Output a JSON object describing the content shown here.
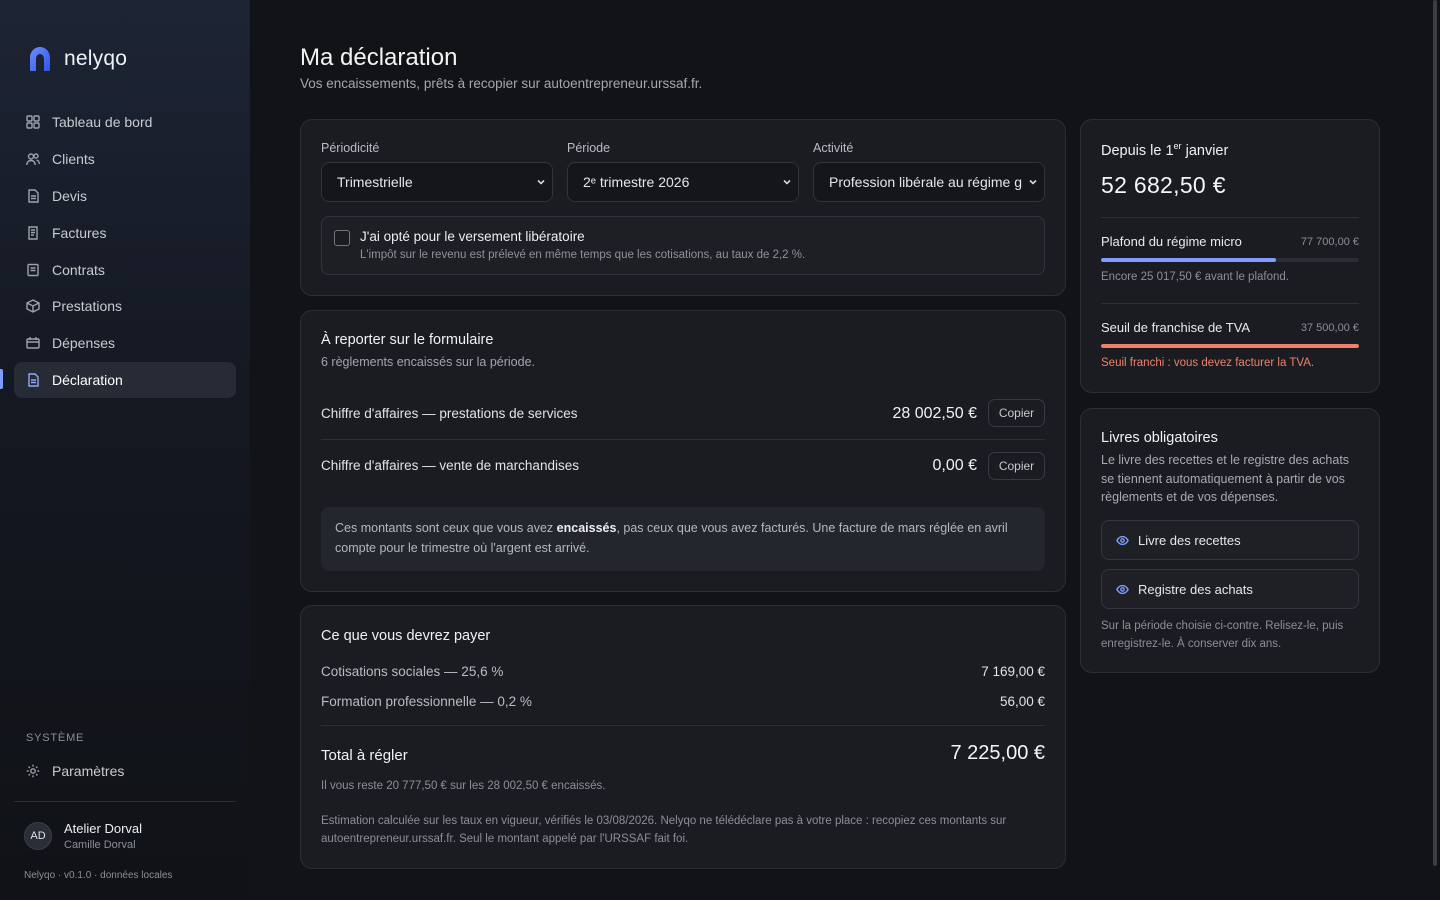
{
  "brand": {
    "name": "nelyqo"
  },
  "nav": {
    "items": [
      {
        "label": "Tableau de bord",
        "icon": "dashboard-icon"
      },
      {
        "label": "Clients",
        "icon": "users-icon"
      },
      {
        "label": "Devis",
        "icon": "document-icon"
      },
      {
        "label": "Factures",
        "icon": "invoice-icon"
      },
      {
        "label": "Contrats",
        "icon": "contract-icon"
      },
      {
        "label": "Prestations",
        "icon": "box-icon"
      },
      {
        "label": "Dépenses",
        "icon": "wallet-icon"
      },
      {
        "label": "Déclaration",
        "icon": "declaration-icon",
        "active": true
      }
    ],
    "system_label": "SYSTÈME",
    "settings_label": "Paramètres"
  },
  "user": {
    "initials": "AD",
    "name": "Atelier Dorval",
    "sub": "Camille Dorval"
  },
  "version": "Nelyqo · v0.1.0 · données locales",
  "page": {
    "title": "Ma déclaration",
    "subtitle": "Vos encaissements, prêts à recopier sur autoentrepreneur.urssaf.fr."
  },
  "filters": {
    "periodicity_label": "Périodicité",
    "periodicity_value": "Trimestrielle",
    "period_label": "Période",
    "period_value": "2ᵉ trimestre 2026",
    "activity_label": "Activité",
    "activity_value": "Profession libérale au régime général",
    "liberatory_title": "J'ai opté pour le versement libératoire",
    "liberatory_desc": "L'impôt sur le revenu est prélevé en même temps que les cotisations, au taux de 2,2 %.",
    "liberatory_checked": false
  },
  "report": {
    "title": "À reporter sur le formulaire",
    "subtitle": "6 règlements encaissés sur la période.",
    "rows": [
      {
        "label": "Chiffre d'affaires — prestations de services",
        "amount": "28 002,50 €",
        "copy": "Copier"
      },
      {
        "label": "Chiffre d'affaires — vente de marchandises",
        "amount": "0,00 €",
        "copy": "Copier"
      }
    ],
    "note_before": "Ces montants sont ceux que vous avez ",
    "note_bold": "encaissés",
    "note_after": ", pas ceux que vous avez facturés. Une facture de mars réglée en avril compte pour le trimestre où l'argent est arrivé."
  },
  "payment": {
    "title": "Ce que vous devrez payer",
    "lines": [
      {
        "label": "Cotisations sociales — 25,6 %",
        "value": "7 169,00 €"
      },
      {
        "label": "Formation professionnelle — 0,2 %",
        "value": "56,00 €"
      }
    ],
    "total_label": "Total à régler",
    "total_value": "7 225,00 €",
    "remaining": "Il vous reste 20 777,50 € sur les 28 002,50 € encaissés.",
    "disclaimer": "Estimation calculée sur les taux en vigueur, vérifiés le 03/08/2026. Nelyqo ne télédéclare pas à votre place : recopiez ces montants sur autoentrepreneur.urssaf.fr. Seul le montant appelé par l'URSSAF fait foi."
  },
  "since": {
    "title_prefix": "Depuis le 1",
    "title_sup": "er",
    "title_suffix": " janvier",
    "amount": "52 682,50 €",
    "micro_label": "Plafond du régime micro",
    "micro_value": "77 700,00 €",
    "micro_progress": 0.678,
    "micro_color": "#7f9cff",
    "micro_note": "Encore 25 017,50 € avant le plafond.",
    "vat_label": "Seuil de franchise de TVA",
    "vat_value": "37 500,00 €",
    "vat_progress": 1.0,
    "vat_color": "#f0806a",
    "vat_note": "Seuil franchi : vous devez facturer la TVA."
  },
  "books": {
    "title": "Livres obligatoires",
    "desc": "Le livre des recettes et le registre des achats se tiennent automatiquement à partir de vos règlements et de vos dépenses.",
    "buttons": [
      {
        "label": "Livre des recettes",
        "icon": "eye-icon"
      },
      {
        "label": "Registre des achats",
        "icon": "eye-icon"
      }
    ],
    "footnote": "Sur la période choisie ci-contre. Relisez-le, puis enregistrez-le. À conserver dix ans."
  }
}
